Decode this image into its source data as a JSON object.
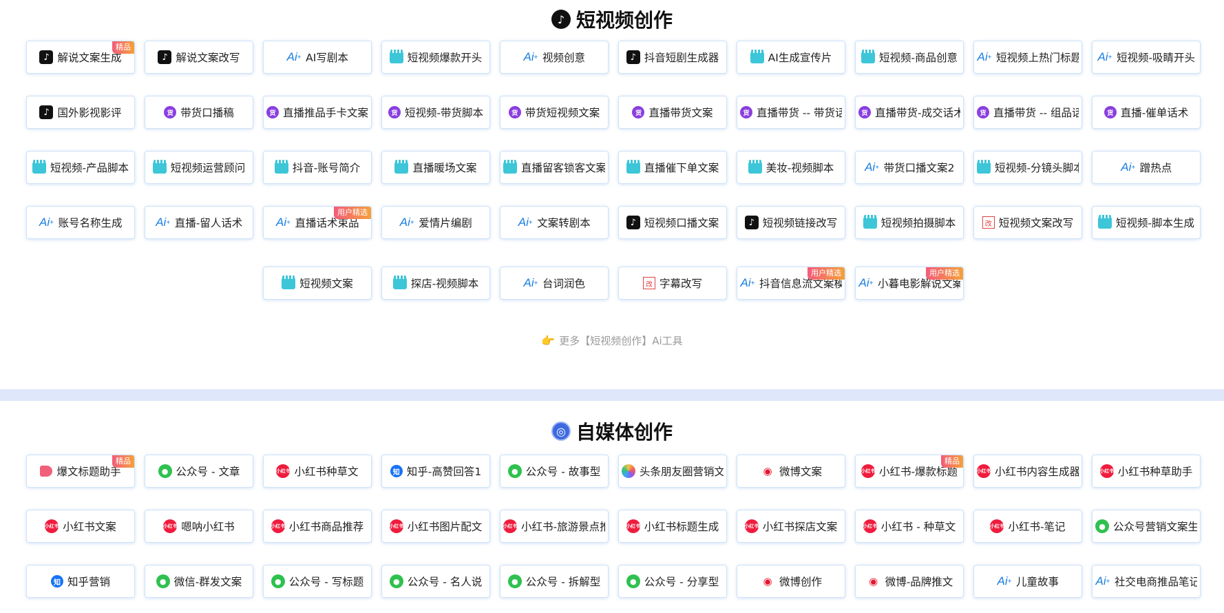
{
  "video_section": {
    "title": "短视频创作",
    "icon": "tiktok-icon",
    "more_link": "更多【短视频创作】Ai工具",
    "tools": [
      {
        "label": "解说文案生成",
        "icon": "tiktok",
        "badge": "精品"
      },
      {
        "label": "解说文案改写",
        "icon": "tiktok"
      },
      {
        "label": "AI写剧本",
        "icon": "ai"
      },
      {
        "label": "短视频爆款开头",
        "icon": "clapper"
      },
      {
        "label": "视频创意",
        "icon": "ai"
      },
      {
        "label": "抖音短剧生成器",
        "icon": "tiktok"
      },
      {
        "label": "AI生成宣传片",
        "icon": "clapper"
      },
      {
        "label": "短视频-商品创意",
        "icon": "clapper"
      },
      {
        "label": "短视频上热门标题",
        "icon": "ai"
      },
      {
        "label": "短视频-吸睛开头",
        "icon": "ai"
      },
      {
        "label": "国外影视影评",
        "icon": "tiktok"
      },
      {
        "label": "带货口播稿",
        "icon": "goods"
      },
      {
        "label": "直播推品手卡文案",
        "icon": "goods"
      },
      {
        "label": "短视频-带货脚本",
        "icon": "goods"
      },
      {
        "label": "带货短视频文案",
        "icon": "goods"
      },
      {
        "label": "直播带货文案",
        "icon": "goods"
      },
      {
        "label": "直播带货 -- 带货话",
        "icon": "goods"
      },
      {
        "label": "直播带货-成交话术",
        "icon": "goods"
      },
      {
        "label": "直播带货 -- 组品话",
        "icon": "goods"
      },
      {
        "label": "直播-催单话术",
        "icon": "goods"
      },
      {
        "label": "短视频-产品脚本",
        "icon": "clapper"
      },
      {
        "label": "短视频运营顾问",
        "icon": "clapper"
      },
      {
        "label": "抖音-账号简介",
        "icon": "clapper"
      },
      {
        "label": "直播暖场文案",
        "icon": "clapper"
      },
      {
        "label": "直播留客锁客文案",
        "icon": "clapper"
      },
      {
        "label": "直播催下单文案",
        "icon": "clapper"
      },
      {
        "label": "美妆-视频脚本",
        "icon": "clapper"
      },
      {
        "label": "带货口播文案2",
        "icon": "ai"
      },
      {
        "label": "短视频-分镜头脚本",
        "icon": "clapper"
      },
      {
        "label": "蹭热点",
        "icon": "ai"
      },
      {
        "label": "账号名称生成",
        "icon": "ai"
      },
      {
        "label": "直播-留人话术",
        "icon": "ai"
      },
      {
        "label": "直播话术束品",
        "icon": "ai",
        "badge": "用户精选"
      },
      {
        "label": "爱情片编剧",
        "icon": "ai"
      },
      {
        "label": "文案转剧本",
        "icon": "ai"
      },
      {
        "label": "短视频口播文案",
        "icon": "tiktok"
      },
      {
        "label": "短视频链接改写",
        "icon": "tiktok"
      },
      {
        "label": "短视频拍摄脚本",
        "icon": "clapper"
      },
      {
        "label": "短视频文案改写",
        "icon": "subtitle"
      },
      {
        "label": "短视频-脚本生成",
        "icon": "clapper"
      }
    ],
    "centered_tools": [
      {
        "label": "短视频文案",
        "icon": "clapper"
      },
      {
        "label": "探店-视频脚本",
        "icon": "clapper"
      },
      {
        "label": "台词润色",
        "icon": "ai"
      },
      {
        "label": "字幕改写",
        "icon": "subtitle"
      },
      {
        "label": "抖音信息流文案模",
        "icon": "ai",
        "badge": "用户精选"
      },
      {
        "label": "小暮电影解说文案",
        "icon": "ai",
        "badge": "用户精选"
      }
    ]
  },
  "media_section": {
    "title": "自媒体创作",
    "icon": "media-icon",
    "tools": [
      {
        "label": "爆文标题助手",
        "icon": "tag",
        "badge": "精品"
      },
      {
        "label": "公众号 - 文章",
        "icon": "wechat"
      },
      {
        "label": "小红书种草文",
        "icon": "xhs"
      },
      {
        "label": "知乎-高赞回答1",
        "icon": "zhihu"
      },
      {
        "label": "公众号 - 故事型",
        "icon": "wechat"
      },
      {
        "label": "头条朋友圈营销文",
        "icon": "pinwheel"
      },
      {
        "label": "微博文案",
        "icon": "weibo"
      },
      {
        "label": "小红书-爆款标题",
        "icon": "xhs",
        "badge": "精品"
      },
      {
        "label": "小红书内容生成器",
        "icon": "xhs"
      },
      {
        "label": "小红书种草助手",
        "icon": "xhs"
      },
      {
        "label": "小红书文案",
        "icon": "xhs"
      },
      {
        "label": "嗯呐小红书",
        "icon": "xhs"
      },
      {
        "label": "小红书商品推荐",
        "icon": "xhs"
      },
      {
        "label": "小红书图片配文",
        "icon": "xhs"
      },
      {
        "label": "小红书-旅游景点推",
        "icon": "xhs"
      },
      {
        "label": "小红书标题生成",
        "icon": "xhs"
      },
      {
        "label": "小红书探店文案",
        "icon": "xhs"
      },
      {
        "label": "小红书 - 种草文",
        "icon": "xhs"
      },
      {
        "label": "小红书-笔记",
        "icon": "xhs"
      },
      {
        "label": "公众号营销文案生",
        "icon": "wechat"
      },
      {
        "label": "知乎营销",
        "icon": "zhihu"
      },
      {
        "label": "微信-群发文案",
        "icon": "wechat"
      },
      {
        "label": "公众号 - 写标题",
        "icon": "wechat"
      },
      {
        "label": "公众号 - 名人说",
        "icon": "wechat"
      },
      {
        "label": "公众号 - 拆解型",
        "icon": "wechat"
      },
      {
        "label": "公众号 - 分享型",
        "icon": "wechat"
      },
      {
        "label": "微博创作",
        "icon": "weibo"
      },
      {
        "label": "微博-品牌推文",
        "icon": "weibo"
      },
      {
        "label": "儿童故事",
        "icon": "ai"
      },
      {
        "label": "社交电商推品笔记",
        "icon": "ai"
      }
    ]
  }
}
